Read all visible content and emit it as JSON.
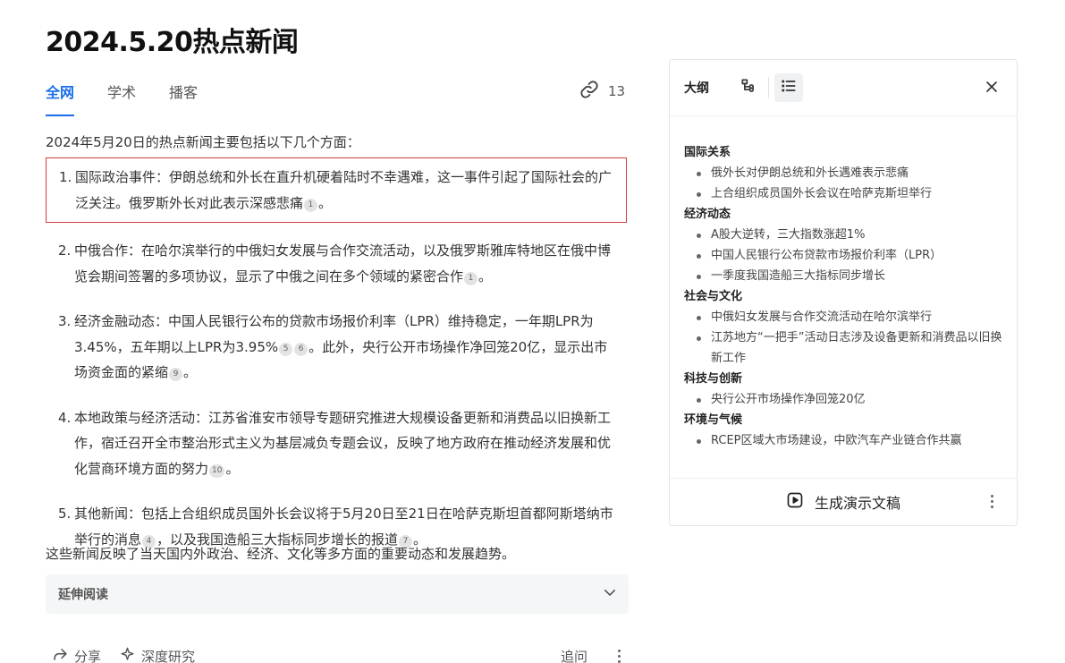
{
  "page_title": "2024.5.20热点新闻",
  "tabs": [
    {
      "label": "全网",
      "active": true
    },
    {
      "label": "学术",
      "active": false
    },
    {
      "label": "播客",
      "active": false
    }
  ],
  "links_count": "13",
  "intro": "2024年5月20日的热点新闻主要包括以下几个方面：",
  "items": [
    {
      "num": "1.",
      "text": "国际政治事件：伊朗总统和外长在直升机硬着陆时不幸遇难，这一事件引起了国际社会的广泛关注。俄罗斯外长对此表示深感悲痛",
      "cites": [
        "1"
      ],
      "tail": "。"
    },
    {
      "num": "2.",
      "text": "中俄合作：在哈尔滨举行的中俄妇女发展与合作交流活动，以及俄罗斯雅库特地区在俄中博览会期间签署的多项协议，显示了中俄之间在多个领域的紧密合作",
      "cites": [
        "1"
      ],
      "tail": "。"
    },
    {
      "num": "3.",
      "text_a": "经济金融动态：中国人民银行公布的贷款市场报价利率（LPR）维持稳定，一年期LPR为3.45%，五年期以上LPR为3.95%",
      "cites_a": [
        "5",
        "6"
      ],
      "text_b": "。此外，央行公开市场操作净回笼20亿，显示出市场资金面的紧缩",
      "cites_b": [
        "9"
      ],
      "tail": "。"
    },
    {
      "num": "4.",
      "text": "本地政策与经济活动：江苏省淮安市领导专题研究推进大规模设备更新和消费品以旧换新工作，宿迁召开全市整治形式主义为基层减负专题会议，反映了地方政府在推动经济发展和优化营商环境方面的努力",
      "cites": [
        "10"
      ],
      "tail": "。"
    },
    {
      "num": "5.",
      "text_a": "其他新闻：包括上合组织成员国外长会议将于5月20日至21日在哈萨克斯坦首都阿斯塔纳市举行的消息",
      "cites_a": [
        "4"
      ],
      "text_b": "，以及我国造船三大指标同步增长的报道",
      "cites_b": [
        "7"
      ],
      "tail": "。"
    }
  ],
  "summary": "这些新闻反映了当天国内外政治、经济、文化等多方面的重要动态和发展趋势。",
  "extended_reading": "延伸阅读",
  "actions": {
    "share": "分享",
    "deep_research": "深度研究",
    "follow_up": "追问"
  },
  "panel": {
    "title": "大纲",
    "generate_label": "生成演示文稿",
    "sections": [
      {
        "title": "国际关系",
        "items": [
          "俄外长对伊朗总统和外长遇难表示悲痛",
          "上合组织成员国外长会议在哈萨克斯坦举行"
        ]
      },
      {
        "title": "经济动态",
        "items": [
          "A股大逆转，三大指数涨超1%",
          "中国人民银行公布贷款市场报价利率（LPR）",
          "一季度我国造船三大指标同步增长"
        ]
      },
      {
        "title": "社会与文化",
        "items": [
          "中俄妇女发展与合作交流活动在哈尔滨举行",
          "江苏地方“一把手”活动日志涉及设备更新和消费品以旧换新工作"
        ]
      },
      {
        "title": "科技与创新",
        "items": [
          "央行公开市场操作净回笼20亿"
        ]
      },
      {
        "title": "环境与气候",
        "items": [
          "RCEP区域大市场建设，中欧汽车产业链合作共赢"
        ]
      }
    ]
  },
  "colors": {
    "accent": "#1a6fe8",
    "highlight_border": "#d23c3c"
  }
}
